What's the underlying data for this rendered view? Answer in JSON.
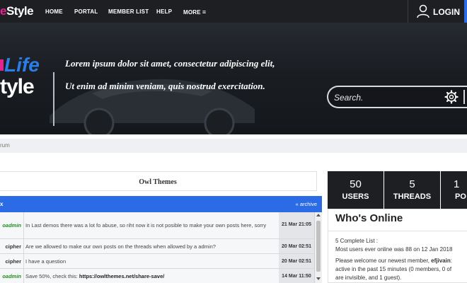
{
  "brand": {
    "left": "e",
    "right": "Style"
  },
  "nav": {
    "items": [
      "HOME",
      "PORTAL",
      "MEMBER LIST",
      "HELP",
      "MORE"
    ],
    "login": "LOGIN"
  },
  "hero": {
    "logo_top": "Life",
    "logo_bottom": "tyle",
    "tagline_1": "Lorem ipsum dolor sit amet, consectetur adipiscing elit,",
    "tagline_2": "Ut enim ad minim veniam, quis nostrud exercitation.",
    "search_placeholder": "Search."
  },
  "breadcrumb": "rum",
  "panel": {
    "title": "Owl Themes"
  },
  "shoutbox": {
    "header": "x",
    "archive": "« archive",
    "rows": [
      {
        "user": "oadmin",
        "message": "In Last demos there was a lot fo abuse, so riht now it is not posible to make your own posts here, sorry",
        "date": "21 Mar 21:05"
      },
      {
        "user": "cipher",
        "message": "Are we allowed to make our own posts on the threads when allowed by a admin?",
        "date": "20 Mar 02:51"
      },
      {
        "user": "cipher",
        "message": "I have a question",
        "date": "20 Mar 02:51"
      },
      {
        "user": "oadmin",
        "message_prefix": "Save 50%, check this: ",
        "message_link": "https://owlthemes.net/share-save/",
        "date": "14 Mar 11:50"
      }
    ]
  },
  "stats": [
    {
      "value": "50",
      "label": "USERS"
    },
    {
      "value": "5",
      "label": "THREADS"
    },
    {
      "value": "1",
      "label": "PO"
    }
  ],
  "whos_online": {
    "title": "Who's Online",
    "line_1": "5 Complete List :",
    "line_2": "Most users ever online was 88 on 12 Jan 2018",
    "line_3_prefix": "Please welcome our newest member, ",
    "line_3_member": "efjivain",
    "line_3_suffix": ":",
    "line_4": "active in the past 15 minutes (0 members, 0 of",
    "line_5": "are invisible, and 1 guest)."
  }
}
